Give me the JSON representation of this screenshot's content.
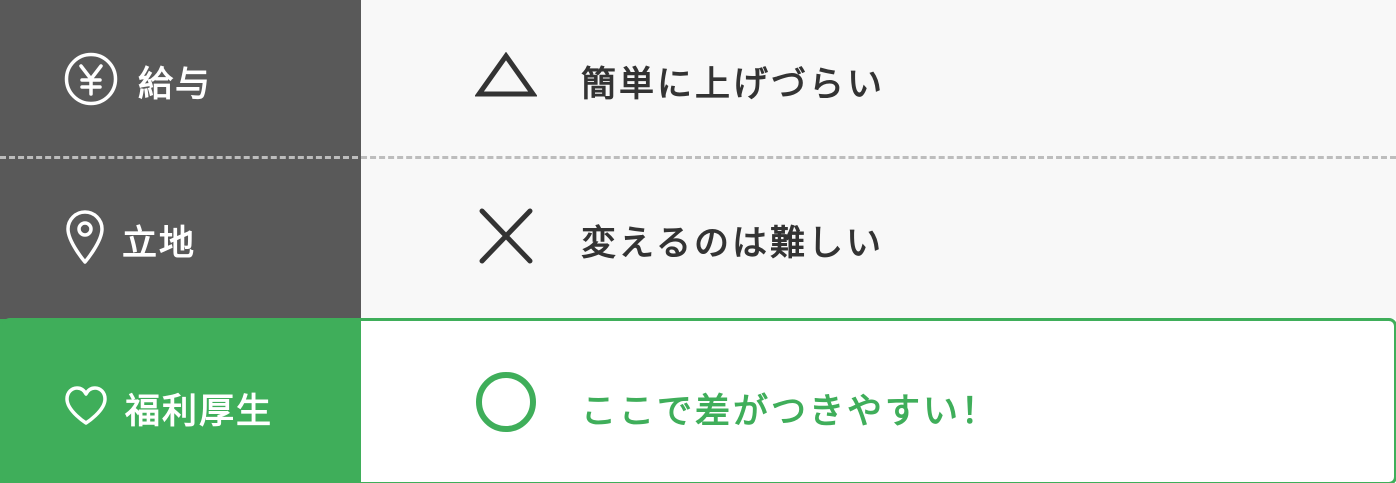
{
  "rows": [
    {
      "label": "給与",
      "label_icon": "yen-circle-icon",
      "mark": "triangle",
      "value": "簡単に上げづらい"
    },
    {
      "label": "立地",
      "label_icon": "location-pin-icon",
      "mark": "cross",
      "value": "変えるのは難しい"
    },
    {
      "label": "福利厚生",
      "label_icon": "heart-icon",
      "mark": "circle",
      "value": "ここで差がつきやすい！"
    }
  ],
  "colors": {
    "dark_cell": "#595959",
    "green_accent": "#3fae5a",
    "light_cell": "#f8f8f8",
    "text_dark": "#333333",
    "divider": "#bdbdbd"
  }
}
